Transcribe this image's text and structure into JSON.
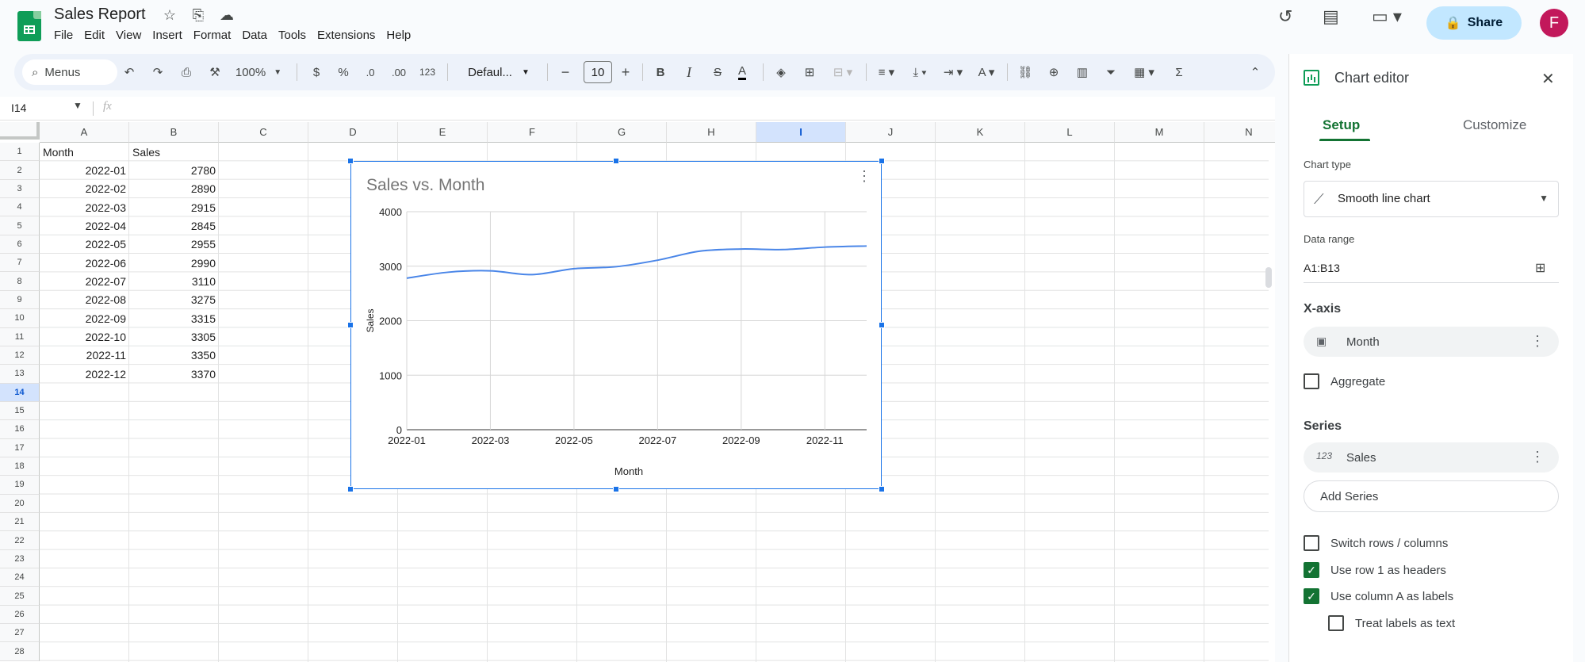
{
  "doc": {
    "title": "Sales Report"
  },
  "menu": [
    "File",
    "Edit",
    "View",
    "Insert",
    "Format",
    "Data",
    "Tools",
    "Extensions",
    "Help"
  ],
  "header": {
    "share_label": "Share",
    "avatar_initial": "F"
  },
  "toolbar": {
    "search_label": "Menus",
    "zoom": "100%",
    "currency": "$",
    "percent": "%",
    "dec_decrease": ".0",
    "dec_increase": ".00",
    "number_format": "123",
    "font": "Defaul...",
    "font_size": "10",
    "bold": "B",
    "italic": "I",
    "strike": "S",
    "text_color": "A",
    "sum": "Σ"
  },
  "formula_bar": {
    "cell_ref": "I14",
    "fx": "fx"
  },
  "columns": [
    "A",
    "B",
    "C",
    "D",
    "E",
    "F",
    "G",
    "H",
    "I",
    "J",
    "K",
    "L",
    "M",
    "N"
  ],
  "selected_column": "I",
  "rows": [
    "1",
    "2",
    "3",
    "4",
    "5",
    "6",
    "7",
    "8",
    "9",
    "10",
    "11",
    "12",
    "13",
    "14",
    "15",
    "16",
    "17",
    "18",
    "19",
    "20",
    "21",
    "22",
    "23",
    "24",
    "25",
    "26",
    "27",
    "28"
  ],
  "selected_row": "14",
  "table": {
    "headers": [
      "Month",
      "Sales"
    ],
    "data": [
      [
        "2022-01",
        "2780"
      ],
      [
        "2022-02",
        "2890"
      ],
      [
        "2022-03",
        "2915"
      ],
      [
        "2022-04",
        "2845"
      ],
      [
        "2022-05",
        "2955"
      ],
      [
        "2022-06",
        "2990"
      ],
      [
        "2022-07",
        "3110"
      ],
      [
        "2022-08",
        "3275"
      ],
      [
        "2022-09",
        "3315"
      ],
      [
        "2022-10",
        "3305"
      ],
      [
        "2022-11",
        "3350"
      ],
      [
        "2022-12",
        "3370"
      ]
    ]
  },
  "chart_data": {
    "type": "line",
    "title": "Sales vs. Month",
    "xlabel": "Month",
    "ylabel": "Sales",
    "categories": [
      "2022-01",
      "2022-02",
      "2022-03",
      "2022-04",
      "2022-05",
      "2022-06",
      "2022-07",
      "2022-08",
      "2022-09",
      "2022-10",
      "2022-11",
      "2022-12"
    ],
    "x_tick_labels": [
      "2022-01",
      "2022-03",
      "2022-05",
      "2022-07",
      "2022-09",
      "2022-11"
    ],
    "y_ticks": [
      0,
      1000,
      2000,
      3000,
      4000
    ],
    "ylim": [
      0,
      4000
    ],
    "series": [
      {
        "name": "Sales",
        "values": [
          2780,
          2890,
          2915,
          2845,
          2955,
          2990,
          3110,
          3275,
          3315,
          3305,
          3350,
          3370
        ],
        "color": "#4a86e8"
      }
    ],
    "grid": true,
    "smooth": true
  },
  "panel": {
    "title": "Chart editor",
    "tabs": [
      "Setup",
      "Customize"
    ],
    "chart_type_label": "Chart type",
    "chart_type": "Smooth line chart",
    "data_range_label": "Data range",
    "data_range": "A1:B13",
    "x_axis_label": "X-axis",
    "x_axis_value": "Month",
    "aggregate_label": "Aggregate",
    "series_label": "Series",
    "series_value": "Sales",
    "series_icon": "123",
    "add_series": "Add Series",
    "options": [
      {
        "label": "Switch rows / columns",
        "checked": false
      },
      {
        "label": "Use row 1 as headers",
        "checked": true
      },
      {
        "label": "Use column A as labels",
        "checked": true
      },
      {
        "label": "Treat labels as text",
        "checked": false
      }
    ]
  },
  "colors": {
    "accent_green": "#137333",
    "selection_blue": "#1a73e8",
    "share_bg": "#c2e7ff",
    "avatar_bg": "#c2185b"
  }
}
